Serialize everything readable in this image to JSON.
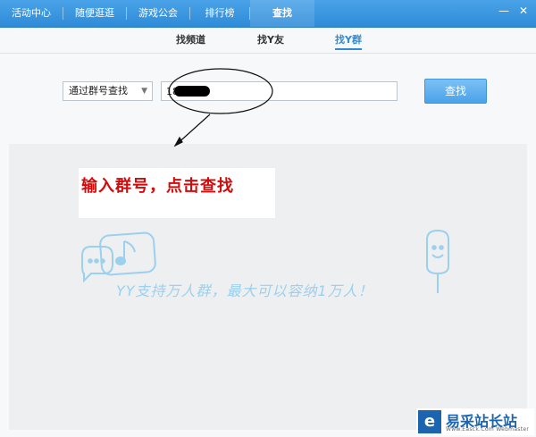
{
  "nav": {
    "items": [
      {
        "label": "活动中心"
      },
      {
        "label": "随便逛逛"
      },
      {
        "label": "游戏公会"
      },
      {
        "label": "排行榜"
      },
      {
        "label": "查找"
      }
    ]
  },
  "window": {
    "minimize": "—",
    "close": "✕"
  },
  "subtabs": [
    {
      "label": "找频道"
    },
    {
      "label": "找Y友"
    },
    {
      "label": "找Y群"
    }
  ],
  "search": {
    "mode_selected": "通过群号查找",
    "input_value": "18",
    "button_label": "查找"
  },
  "annotation": {
    "text": "输入群号，点击查找"
  },
  "empty_state": {
    "slogan": "YY支持万人群，最大可以容纳1万人！"
  },
  "watermark": {
    "logo_glyph": "e",
    "text": "易采站长站",
    "subtext": "Www.Easck.Com Webmaster"
  },
  "colors": {
    "nav_bg": "#2f8bd8",
    "accent": "#2f8bd8",
    "annotation_red": "#d10b0b",
    "slogan_blue": "#9bd0ee"
  }
}
